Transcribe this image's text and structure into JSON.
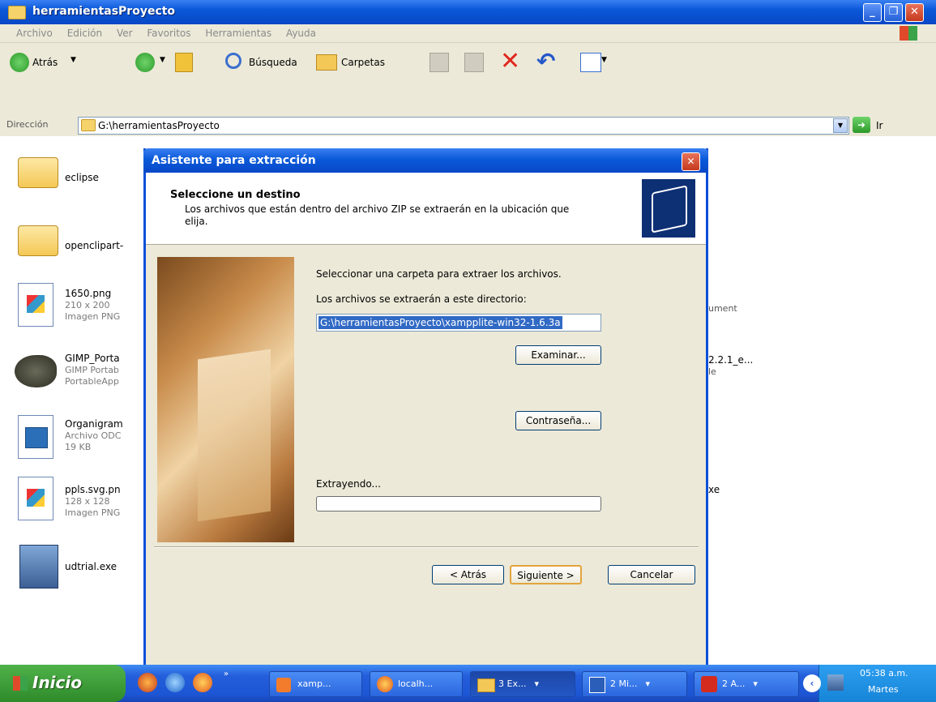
{
  "window": {
    "title": "herramientasProyecto"
  },
  "menu": [
    "Archivo",
    "Edición",
    "Ver",
    "Favoritos",
    "Herramientas",
    "Ayuda"
  ],
  "toolbar": {
    "back_label": "Atrás",
    "search_label": "Búsqueda",
    "folders_label": "Carpetas"
  },
  "address": {
    "label": "Dirección",
    "path": "G:\\herramientasProyecto",
    "go_label": "Ir"
  },
  "files": [
    {
      "name": "eclipse",
      "sub1": "",
      "sub2": "",
      "sub3": ""
    },
    {
      "name": "openclipart-",
      "sub1": "",
      "sub2": "",
      "sub3": ""
    },
    {
      "name": "1650.png",
      "sub1": "210 x 200",
      "sub2": "Imagen PNG",
      "sub3": ""
    },
    {
      "name": "GIMP_Porta",
      "sub1": "GIMP Portab",
      "sub2": "PortableApp",
      "sub3": ""
    },
    {
      "name": "Organigram",
      "sub1": "Archivo ODC",
      "sub2": "19 KB",
      "sub3": ""
    },
    {
      "name": "ppls.svg.pn",
      "sub1": "128 x 128",
      "sub2": "Imagen PNG",
      "sub3": ""
    },
    {
      "name": "udtrial.exe",
      "sub1": "",
      "sub2": "",
      "sub3": ""
    }
  ],
  "right_fragments": [
    "ument",
    "2.2.1_e...",
    "le",
    "xe"
  ],
  "dialog": {
    "title": "Asistente para extracción",
    "heading": "Seleccione un destino",
    "description_line1": "Los archivos que están dentro del archivo ZIP se extraerán en la ubicación que",
    "description_line2": "elija.",
    "select_folder_text": "Seleccionar una carpeta para extraer los archivos.",
    "dir_label": "Los archivos se extraerán a este directorio:",
    "dir_value": "G:\\herramientasProyecto\\xampplite-win32-1.6.3a",
    "browse_button": "Examinar...",
    "password_button": "Contraseña...",
    "extracting_label": "Extrayendo...",
    "progress": 0,
    "back_button": "< Atrás",
    "next_button": "Siguiente >",
    "cancel_button": "Cancelar"
  },
  "taskbar": {
    "start_label": "Inicio",
    "tasks": [
      "xamp...",
      "localh...",
      "3 Ex...",
      "2 Mi...",
      "2 A..."
    ],
    "time": "05:38 a.m.",
    "day": "Martes"
  }
}
